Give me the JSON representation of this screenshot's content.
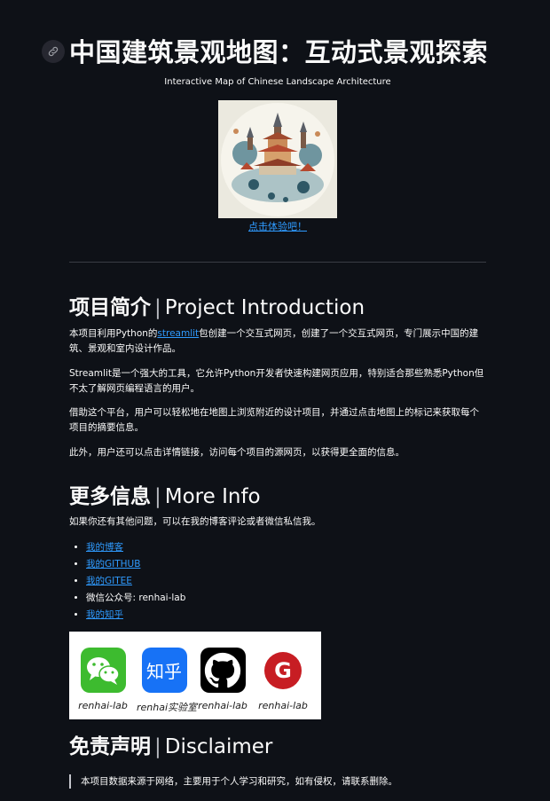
{
  "header": {
    "title": "中国建筑景观地图：互动式景观探索",
    "subtitle": "Interactive Map of Chinese Landscape Architecture",
    "cta_link": "点击体验吧！"
  },
  "intro": {
    "heading_zh": "项目简介",
    "heading_sep": "|",
    "heading_en": "Project Introduction",
    "p1_pre": "本项目利用Python的",
    "p1_link": "streamlit",
    "p1_post": "包创建一个交互式网页，创建了一个交互式网页，专门展示中国的建筑、景观和室内设计作品。",
    "p2": "Streamlit是一个强大的工具，它允许Python开发者快速构建网页应用，特别适合那些熟悉Python但不太了解网页编程语言的用户。",
    "p3": "借助这个平台，用户可以轻松地在地图上浏览附近的设计项目，并通过点击地图上的标记来获取每个项目的摘要信息。",
    "p4": "此外，用户还可以点击详情链接，访问每个项目的源网页，以获得更全面的信息。"
  },
  "more_info": {
    "heading_zh": "更多信息",
    "heading_sep": "|",
    "heading_en": "More Info",
    "text": "如果你还有其他问题，可以在我的博客评论或者微信私信我。",
    "links": [
      {
        "label": "我的博客",
        "is_link": true
      },
      {
        "label": "我的GITHUB",
        "is_link": true
      },
      {
        "label": "我的GITEE",
        "is_link": true
      },
      {
        "label": "微信公众号: renhai-lab",
        "is_link": false
      },
      {
        "label": "我的知乎",
        "is_link": true
      }
    ]
  },
  "social": [
    {
      "icon": "wechat-icon",
      "caption": "renhai-lab",
      "color": "#3dbb2f"
    },
    {
      "icon": "zhihu-icon",
      "logo_text": "知乎",
      "caption": "renhai实验室",
      "color": "#1772f6"
    },
    {
      "icon": "github-icon",
      "caption": "renhai-lab",
      "color": "#000000"
    },
    {
      "icon": "gitee-icon",
      "logo_text": "G",
      "caption": "renhai-lab",
      "color": "#c71d23"
    }
  ],
  "disclaimer": {
    "heading_zh": "免责声明",
    "heading_sep": "|",
    "heading_en": "Disclaimer",
    "text": "本项目数据来源于网络，主要用于个人学习和研究，如有侵权，请联系删除。"
  },
  "colors": {
    "background": "#0e1117",
    "text": "#fafafa",
    "link": "#2f9bff"
  }
}
